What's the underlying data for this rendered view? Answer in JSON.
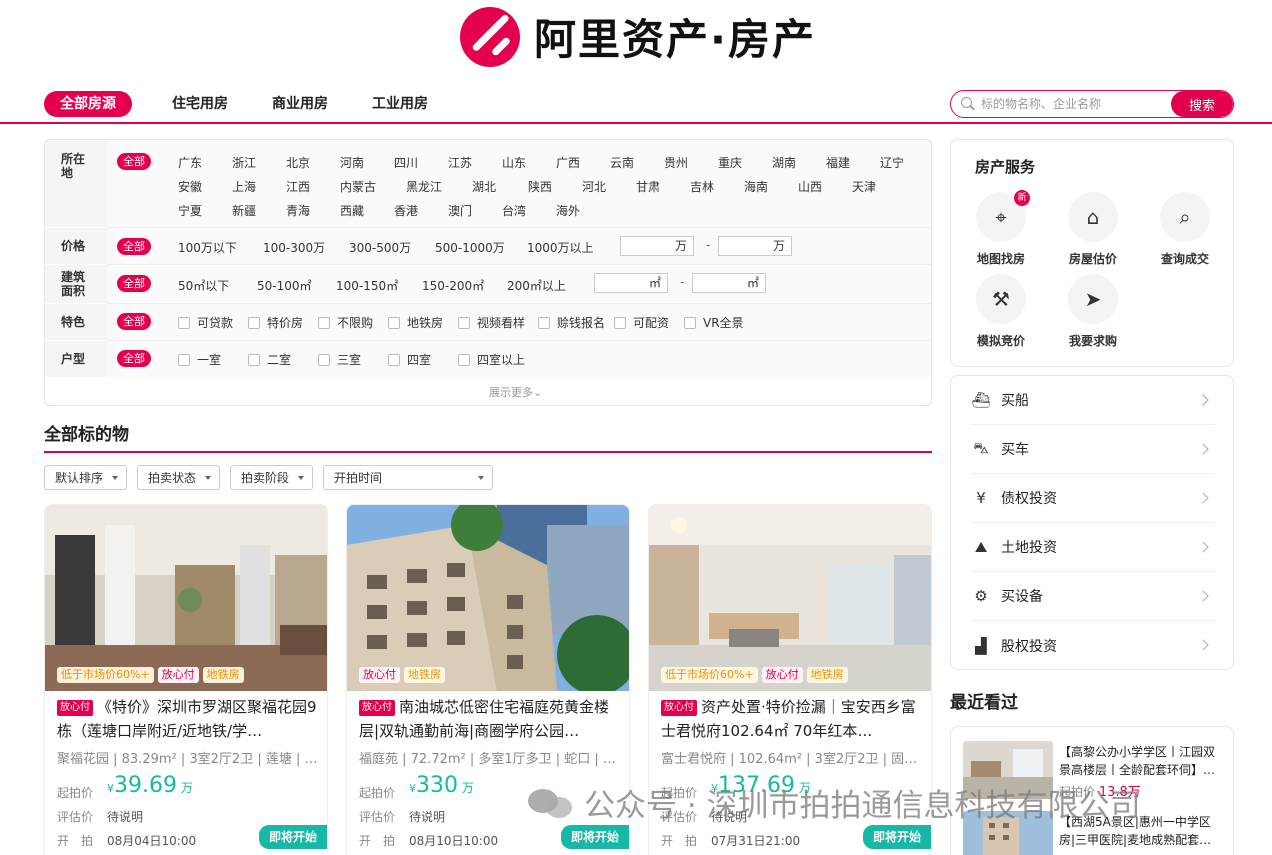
{
  "brand": {
    "name": "阿里资产·房产",
    "accent": "#e5004f"
  },
  "nav": {
    "tabs": [
      "全部房源",
      "住宅用房",
      "商业用房",
      "工业用房"
    ]
  },
  "search": {
    "placeholder": "标的物名称、企业名称",
    "button": "搜索"
  },
  "filters": {
    "location": {
      "label": "所在地",
      "all": "全部",
      "options": [
        "广东",
        "浙江",
        "北京",
        "河南",
        "四川",
        "江苏",
        "山东",
        "广西",
        "云南",
        "贵州",
        "重庆",
        "湖南",
        "福建",
        "辽宁",
        "安徽",
        "上海",
        "江西",
        "内蒙古",
        "黑龙江",
        "湖北",
        "陕西",
        "河北",
        "甘肃",
        "吉林",
        "海南",
        "山西",
        "天津",
        "宁夏",
        "新疆",
        "青海",
        "西藏",
        "香港",
        "澳门",
        "台湾",
        "海外"
      ]
    },
    "price": {
      "label": "价格",
      "all": "全部",
      "options": [
        "100万以下",
        "100-300万",
        "300-500万",
        "500-1000万",
        "1000万以上"
      ],
      "unit": "万",
      "dash": "-"
    },
    "area": {
      "label": "建筑面积",
      "all": "全部",
      "options": [
        "50㎡以下",
        "50-100㎡",
        "100-150㎡",
        "150-200㎡",
        "200㎡以上"
      ],
      "unit": "㎡",
      "dash": "-"
    },
    "feature": {
      "label": "特色",
      "all": "全部",
      "options": [
        "可贷款",
        "特价房",
        "不限购",
        "地铁房",
        "视频看样",
        "赊钱报名",
        "可配资",
        "VR全景"
      ]
    },
    "layout": {
      "label": "户型",
      "all": "全部",
      "options": [
        "一室",
        "二室",
        "三室",
        "四室",
        "四室以上"
      ]
    },
    "more": "展示更多⌄"
  },
  "section": {
    "title": "全部标的物",
    "sorts": [
      "默认排序",
      "拍卖状态",
      "拍卖阶段",
      "开拍时间"
    ]
  },
  "cards": [
    {
      "tags": [
        "低于市场价60%+",
        "放心付",
        "地铁房"
      ],
      "badge": "放心付",
      "title": "《特价》深圳市罗湖区聚福花园9栋（莲塘口岸附近/近地铁/学…",
      "sub": "聚福花园 | 83.29m² | 3室2厅2卫 | 莲塘 | …",
      "price_label": "起拍价",
      "currency": "¥",
      "price": "39.69",
      "unit": "万",
      "eval_label": "评估价",
      "eval": "待说明",
      "time_label": "开　拍",
      "time": "08月04日10:00",
      "status": "即将开始"
    },
    {
      "tags": [
        "放心付",
        "地铁房"
      ],
      "badge": "放心付",
      "title": "南油城芯低密住宅福庭苑黄金楼层|双轨通勤前海|商圈学府公园…",
      "sub": "福庭苑 | 72.72m² | 多室1厅多卫 | 蛇口 | …",
      "price_label": "起拍价",
      "currency": "¥",
      "price": "330",
      "unit": "万",
      "eval_label": "评估价",
      "eval": "待说明",
      "time_label": "开　拍",
      "time": "08月10日10:00",
      "status": "即将开始"
    },
    {
      "tags": [
        "低于市场价60%+",
        "放心付",
        "地铁房"
      ],
      "badge": "放心付",
      "title": "资产处置·特价捡漏｜宝安西乡富士君悦府102.64㎡ 70年红本…",
      "sub": "富士君悦府 | 102.64m² | 3室2厅2卫 | 固…",
      "price_label": "起拍价",
      "currency": "¥",
      "price": "137.69",
      "unit": "万",
      "eval_label": "评估价",
      "eval": "待说明",
      "time_label": "开　拍",
      "time": "07月31日21:00",
      "status": "即将开始"
    }
  ],
  "services": {
    "title": "房产服务",
    "items": [
      {
        "label": "地图找房",
        "icon": "map-pin-icon",
        "glyph": "⌖",
        "badge": "新"
      },
      {
        "label": "房屋估价",
        "icon": "house-yen-icon",
        "glyph": "⌂"
      },
      {
        "label": "查询成交",
        "icon": "search-doc-icon",
        "glyph": "⌕"
      },
      {
        "label": "模拟竞价",
        "icon": "gavel-icon",
        "glyph": "⚒"
      },
      {
        "label": "我要求购",
        "icon": "paper-plane-icon",
        "glyph": "➤"
      }
    ]
  },
  "categories": [
    {
      "label": "买船",
      "icon": "ship-icon",
      "glyph": "⛴"
    },
    {
      "label": "买车",
      "icon": "car-icon",
      "glyph": "⛍"
    },
    {
      "label": "债权投资",
      "icon": "yen-circle-icon",
      "glyph": "¥"
    },
    {
      "label": "土地投资",
      "icon": "land-icon",
      "glyph": "⛰"
    },
    {
      "label": "买设备",
      "icon": "equipment-icon",
      "glyph": "⚙"
    },
    {
      "label": "股权投资",
      "icon": "stock-chart-icon",
      "glyph": "▟"
    }
  ],
  "recent": {
    "title": "最近看过",
    "items": [
      {
        "text": "【高黎公办小学学区丨江园双景高楼层丨全龄配套环伺】…",
        "price_label": "起拍价",
        "price": "13.8万"
      },
      {
        "text": "【西湖5A景区|惠州一中学区房|三甲医院|麦地成熟配套…",
        "price_label": "",
        "price": ""
      }
    ]
  },
  "watermark": "公众号 · 深圳市拍拍通信息科技有限公司"
}
